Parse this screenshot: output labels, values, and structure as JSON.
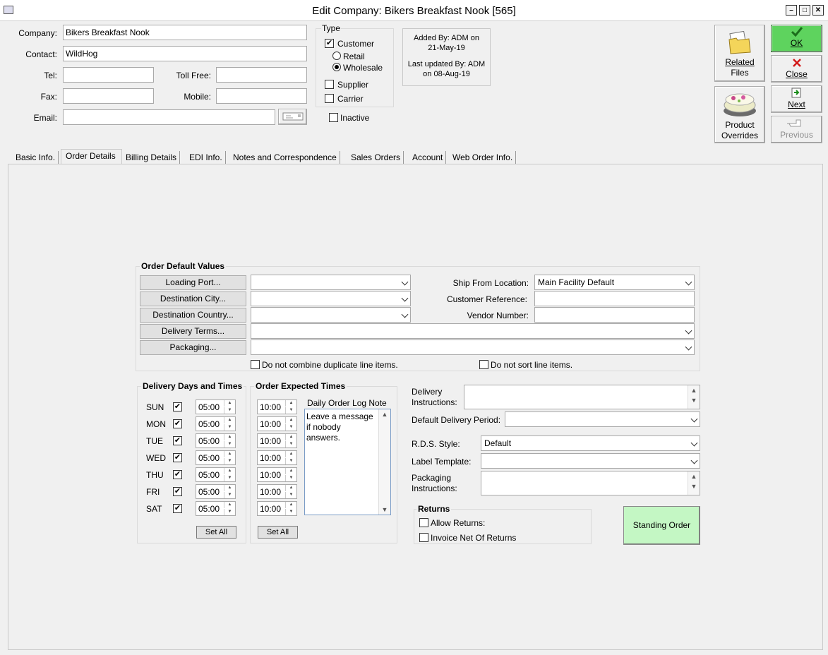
{
  "window": {
    "title": "Edit Company: Bikers Breakfast Nook [565]",
    "minimize": "–",
    "maximize": "□",
    "close": "✕"
  },
  "header": {
    "company_label": "Company:",
    "company_value": "Bikers Breakfast Nook",
    "contact_label": "Contact:",
    "contact_value": "WildHog",
    "tel_label": "Tel:",
    "tel_value": "",
    "tollfree_label": "Toll Free:",
    "tollfree_value": "",
    "fax_label": "Fax:",
    "fax_value": "",
    "mobile_label": "Mobile:",
    "mobile_value": "",
    "email_label": "Email:",
    "email_value": ""
  },
  "type": {
    "title": "Type",
    "customer": "Customer",
    "retail": "Retail",
    "wholesale": "Wholesale",
    "supplier": "Supplier",
    "carrier": "Carrier",
    "inactive": "Inactive",
    "customer_checked": "✔"
  },
  "audit": {
    "added_line1": "Added By: ADM on",
    "added_line2": "21-May-19",
    "updated_line1": "Last updated By: ADM",
    "updated_line2": "on 08-Aug-19"
  },
  "actions": {
    "related_files_1": "Related",
    "related_files_2": "Files",
    "product_overrides_1": "Product",
    "product_overrides_2": "Overrides",
    "ok": "OK",
    "close": "Close",
    "next": "Next",
    "previous": "Previous",
    "ok_color": "#5ed35e"
  },
  "tabs": [
    "Basic Info.",
    "Order Details",
    "Billing Details",
    "EDI Info.",
    "Notes and Correspondence",
    "Sales Orders",
    "Account",
    "Web Order Info."
  ],
  "order_defaults": {
    "title": "Order Default Values",
    "loading_port": "Loading Port...",
    "destination_city": "Destination City...",
    "destination_country": "Destination Country...",
    "delivery_terms": "Delivery Terms...",
    "packaging": "Packaging...",
    "ship_from_label": "Ship From Location:",
    "ship_from_value": "Main Facility Default",
    "customer_ref_label": "Customer Reference:",
    "vendor_number_label": "Vendor Number:",
    "no_combine": "Do not combine duplicate line items.",
    "no_sort": "Do not sort line items."
  },
  "delivery_days": {
    "title": "Delivery Days and Times",
    "days": [
      {
        "day": "SUN",
        "time": "05:00",
        "mark": "✔"
      },
      {
        "day": "MON",
        "time": "05:00",
        "mark": "✔"
      },
      {
        "day": "TUE",
        "time": "05:00",
        "mark": "✔"
      },
      {
        "day": "WED",
        "time": "05:00",
        "mark": "✔"
      },
      {
        "day": "THU",
        "time": "05:00",
        "mark": "✔"
      },
      {
        "day": "FRI",
        "time": "05:00",
        "mark": "✔"
      },
      {
        "day": "SAT",
        "time": "05:00",
        "mark": "✔"
      }
    ],
    "set_all": "Set All"
  },
  "order_expected": {
    "title": "Order Expected Times",
    "times": [
      "10:00",
      "10:00",
      "10:00",
      "10:00",
      "10:00",
      "10:00",
      "10:00"
    ],
    "set_all": "Set All",
    "log_note_label": "Daily Order Log Note",
    "log_note_lines": [
      "Leave a message",
      "if nobody",
      "answers."
    ]
  },
  "delivery": {
    "instructions_label_1": "Delivery",
    "instructions_label_2": "Instructions:",
    "period_label": "Default Delivery Period:",
    "rds_label": "R.D.S. Style:",
    "rds_value": "Default",
    "label_template_label": "Label Template:",
    "packaging_label_1": "Packaging",
    "packaging_label_2": "Instructions:"
  },
  "returns": {
    "title": "Returns",
    "allow": "Allow Returns:",
    "invoice_net": "Invoice Net Of Returns"
  },
  "standing_order": {
    "label": "Standing Order",
    "color": "#c4f7c4"
  }
}
